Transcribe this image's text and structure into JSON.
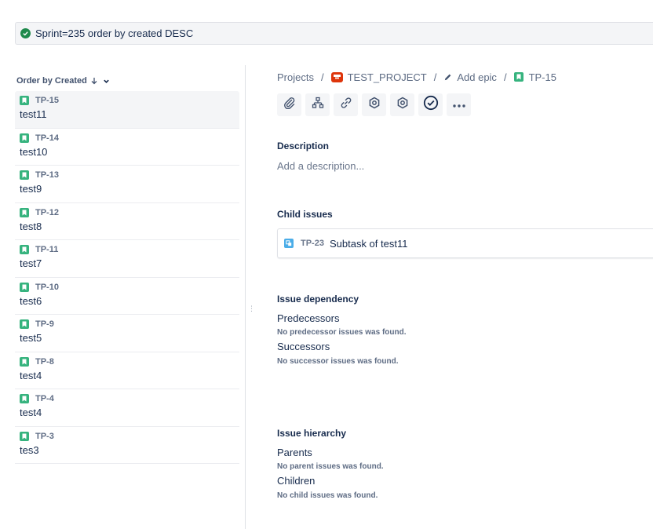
{
  "jql": {
    "query": "Sprint=235 order by created DESC"
  },
  "sidebar": {
    "order_by_label": "Order by Created",
    "issues": [
      {
        "key": "TP-15",
        "summary": "test11",
        "selected": true
      },
      {
        "key": "TP-14",
        "summary": "test10"
      },
      {
        "key": "TP-13",
        "summary": "test9"
      },
      {
        "key": "TP-12",
        "summary": "test8"
      },
      {
        "key": "TP-11",
        "summary": "test7"
      },
      {
        "key": "TP-10",
        "summary": "test6"
      },
      {
        "key": "TP-9",
        "summary": "test5"
      },
      {
        "key": "TP-8",
        "summary": "test4"
      },
      {
        "key": "TP-4",
        "summary": "test4"
      },
      {
        "key": "TP-3",
        "summary": "tes3"
      }
    ]
  },
  "breadcrumbs": {
    "projects": "Projects",
    "project": "TEST_PROJECT",
    "epic": "Add epic",
    "issue": "TP-15",
    "separator": "/"
  },
  "toolbar": {
    "icons": [
      "attachment-icon",
      "hierarchy-icon",
      "link-icon",
      "hexagon-icon",
      "hexagon-icon",
      "check-circle-icon",
      "more-icon"
    ]
  },
  "description": {
    "title": "Description",
    "placeholder": "Add a description..."
  },
  "child_issues": {
    "title": "Child issues",
    "items": [
      {
        "key": "TP-23",
        "summary": "Subtask of test11"
      }
    ]
  },
  "dependency": {
    "title": "Issue dependency",
    "predecessors_label": "Predecessors",
    "predecessors_empty": "No predecessor issues was found.",
    "successors_label": "Successors",
    "successors_empty": "No successor issues was found."
  },
  "hierarchy": {
    "title": "Issue hierarchy",
    "parents_label": "Parents",
    "parents_empty": "No parent issues was found.",
    "children_label": "Children",
    "children_empty": "No child issues was found."
  },
  "colors": {
    "story": "#36b37e",
    "subtask": "#4bade8",
    "project": "#de350b",
    "success": "#1f8a4c"
  }
}
